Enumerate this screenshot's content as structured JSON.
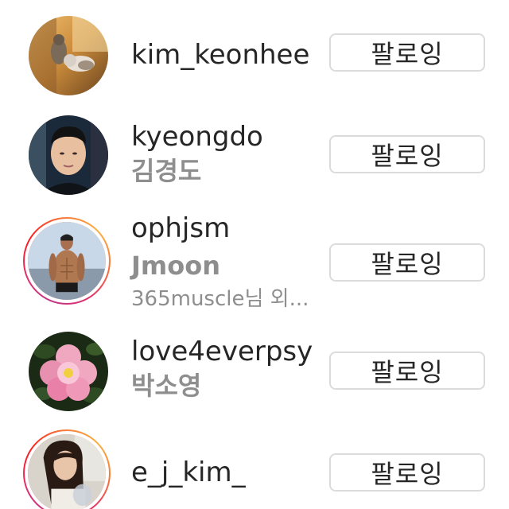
{
  "following_list": [
    {
      "username": "kim_keonhee",
      "full_name": "",
      "subtitle": "",
      "has_story": false,
      "avatar": "cats-sunlight-photo",
      "button_label": "팔로잉"
    },
    {
      "username": "kyeongdo",
      "full_name": "김경도",
      "subtitle": "",
      "has_story": false,
      "avatar": "man-portrait-photo",
      "button_label": "팔로잉"
    },
    {
      "username": "ophjsm",
      "full_name": "Jmoon",
      "subtitle": "365muscle님 외...",
      "has_story": true,
      "avatar": "fitness-model-photo",
      "button_label": "팔로잉"
    },
    {
      "username": "love4everpsy",
      "full_name": "박소영",
      "subtitle": "",
      "has_story": false,
      "avatar": "pink-flower-photo",
      "button_label": "팔로잉"
    },
    {
      "username": "e_j_kim_",
      "full_name": "",
      "subtitle": "",
      "has_story": true,
      "avatar": "woman-portrait-photo",
      "button_label": "팔로잉"
    }
  ],
  "colors": {
    "username": "#262626",
    "secondary_text": "#8e8e8e",
    "button_border": "#dbdbdb",
    "story_ring": [
      "#c13584",
      "#e1306c",
      "#f77737",
      "#fcaf45"
    ]
  }
}
